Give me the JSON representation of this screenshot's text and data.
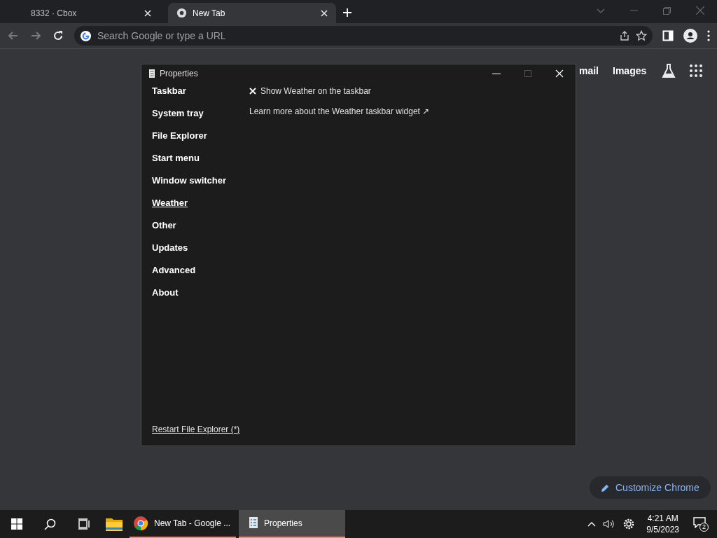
{
  "browser": {
    "tabs": [
      {
        "title": "8332 · Cbox",
        "selected": false
      },
      {
        "title": "New Tab",
        "selected": true
      }
    ],
    "address_bar": {
      "placeholder": "Search Google or type a URL"
    },
    "page": {
      "links": [
        "mail",
        "Images"
      ],
      "customize_button": "Customize Chrome"
    }
  },
  "window": {
    "title": "Properties",
    "sidebar": {
      "items": [
        {
          "label": "Taskbar",
          "selected": false
        },
        {
          "label": "System tray",
          "selected": false
        },
        {
          "label": "File Explorer",
          "selected": false
        },
        {
          "label": "Start menu",
          "selected": false
        },
        {
          "label": "Window switcher",
          "selected": false
        },
        {
          "label": "Weather",
          "selected": true
        },
        {
          "label": "Other",
          "selected": false
        },
        {
          "label": "Updates",
          "selected": false
        },
        {
          "label": "Advanced",
          "selected": false
        },
        {
          "label": "About",
          "selected": false
        }
      ],
      "footer_link": "Restart File Explorer (*)"
    },
    "content": {
      "option": {
        "label": "Show Weather on the taskbar",
        "checked": false
      },
      "link": "Learn more about the Weather taskbar widget ↗"
    }
  },
  "taskbar": {
    "apps": [
      {
        "kind": "chrome",
        "label": "New Tab - Google ...",
        "selected": false
      },
      {
        "kind": "properties",
        "label": "Properties",
        "selected": true
      }
    ],
    "time": "4:21 AM",
    "date": "9/5/2023",
    "notifications": "2"
  }
}
